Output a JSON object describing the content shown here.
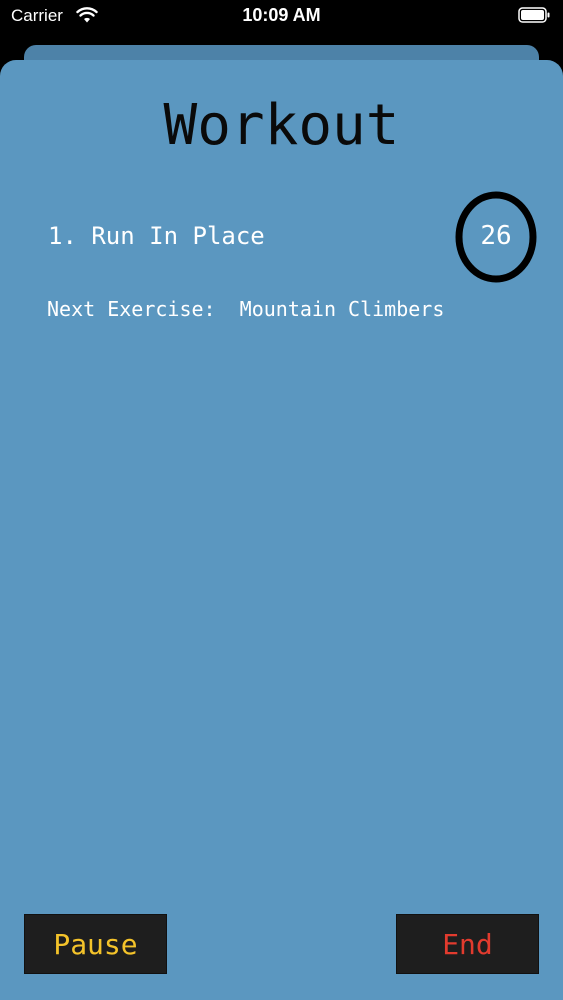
{
  "status_bar": {
    "carrier": "Carrier",
    "time": "10:09 AM",
    "icons": [
      "wifi-icon",
      "battery-icon"
    ]
  },
  "workout": {
    "title": "Workout",
    "current_exercise": "1. Run In Place",
    "timer": "26",
    "next_label": "Next Exercise:",
    "next_exercise": "Mountain Climbers"
  },
  "buttons": {
    "pause_label": "Pause",
    "end_label": "End"
  },
  "colors": {
    "background": "#5b97c0",
    "pause": "#f4c32a",
    "end": "#e23b2e",
    "button_bg": "#1e1e1e"
  }
}
